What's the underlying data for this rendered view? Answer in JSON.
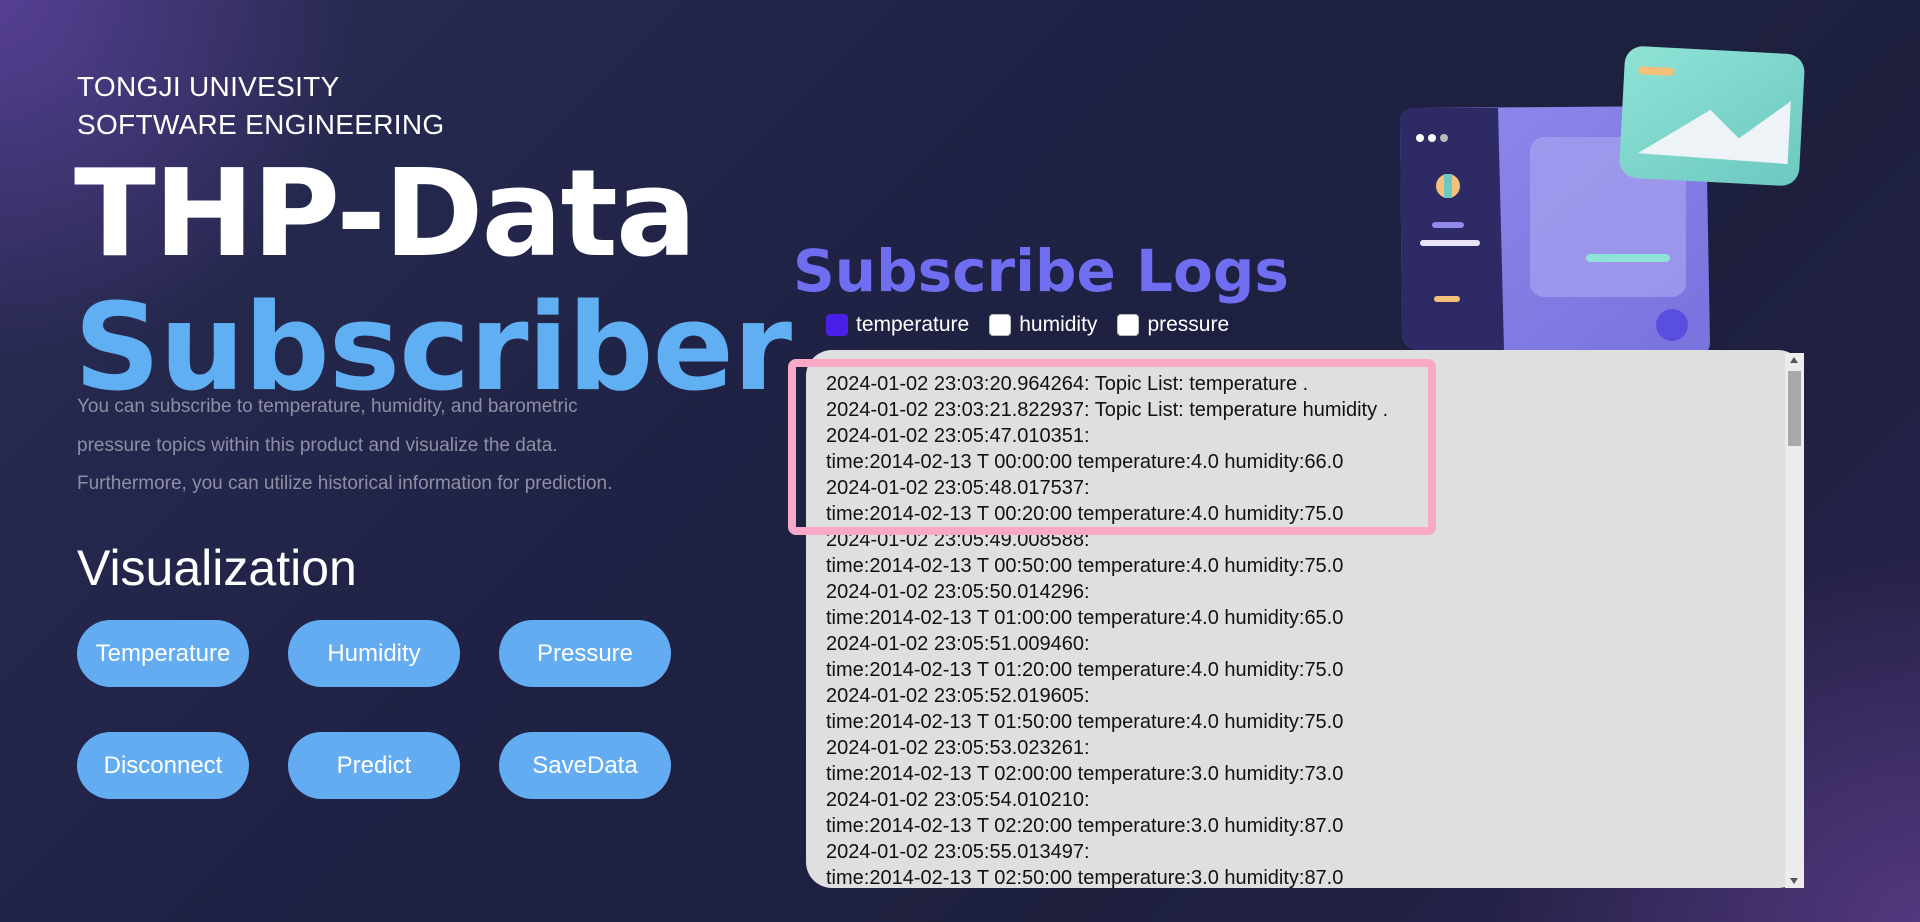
{
  "header": {
    "university": "TONGJI UNIVESITY",
    "department": "SOFTWARE ENGINEERING",
    "title_line1": "THP-Data",
    "title_line2": "Subscriber",
    "description": "You can subscribe to temperature, humidity, and barometric pressure topics within this product and visualize the data. Furthermore, you can utilize historical information for prediction."
  },
  "visualization": {
    "title": "Visualization",
    "buttons": [
      "Temperature",
      "Humidity",
      "Pressure",
      "Disconnect",
      "Predict",
      "SaveData"
    ]
  },
  "logs": {
    "title": "Subscribe Logs",
    "topics": [
      {
        "label": "temperature",
        "checked": true
      },
      {
        "label": "humidity",
        "checked": false
      },
      {
        "label": "pressure",
        "checked": false
      }
    ],
    "lines": [
      "2024-01-02 23:03:20.964264: Topic List: temperature .",
      "2024-01-02 23:03:21.822937: Topic List: temperature humidity .",
      "2024-01-02 23:05:47.010351:",
      "time:2014-02-13 T 00:00:00 temperature:4.0 humidity:66.0",
      "2024-01-02 23:05:48.017537:",
      "time:2014-02-13 T 00:20:00 temperature:4.0 humidity:75.0",
      "2024-01-02 23:05:49.008588:",
      "time:2014-02-13 T 00:50:00 temperature:4.0 humidity:75.0",
      "2024-01-02 23:05:50.014296:",
      "time:2014-02-13 T 01:00:00 temperature:4.0 humidity:65.0",
      "2024-01-02 23:05:51.009460:",
      "time:2014-02-13 T 01:20:00 temperature:4.0 humidity:75.0",
      "2024-01-02 23:05:52.019605:",
      "time:2014-02-13 T 01:50:00 temperature:4.0 humidity:75.0",
      "2024-01-02 23:05:53.023261:",
      "time:2014-02-13 T 02:00:00 temperature:3.0 humidity:73.0",
      "2024-01-02 23:05:54.010210:",
      "time:2014-02-13 T 02:20:00 temperature:3.0 humidity:87.0",
      "2024-01-02 23:05:55.013497:",
      "time:2014-02-13 T 02:50:00 temperature:3.0 humidity:87.0"
    ]
  },
  "colors": {
    "accent_blue": "#63acf2",
    "logs_title": "#6f6ef0",
    "checkbox_checked": "#4a1fe8",
    "highlight": "#f7a9c6"
  }
}
